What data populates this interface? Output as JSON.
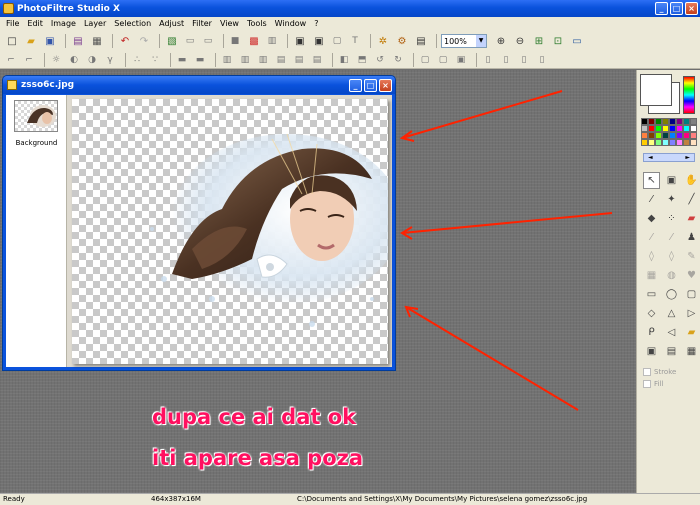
{
  "window": {
    "title": "PhotoFiltre Studio X"
  },
  "menu": [
    "File",
    "Edit",
    "Image",
    "Layer",
    "Selection",
    "Adjust",
    "Filter",
    "View",
    "Tools",
    "Window",
    "?"
  ],
  "toolbar": {
    "zoom": "100%"
  },
  "document": {
    "title": "zsso6c.jpg",
    "layer_label": "Background"
  },
  "annotation": {
    "line1": "dupa ce ai dat ok",
    "line2": "iti apare asa poza"
  },
  "right_panel": {
    "stroke_label": "Stroke",
    "fill_label": "Fill"
  },
  "status": {
    "ready": "Ready",
    "dimensions": "464x387x16M",
    "path": "C:\\Documents and Settings\\X\\My Documents\\My Pictures\\selena gomez\\zsso6c.jpg"
  },
  "colors": {
    "title_blue": "#0a52dc",
    "arrow_red": "#ff2200",
    "annotation_pink": "#ff1060"
  }
}
